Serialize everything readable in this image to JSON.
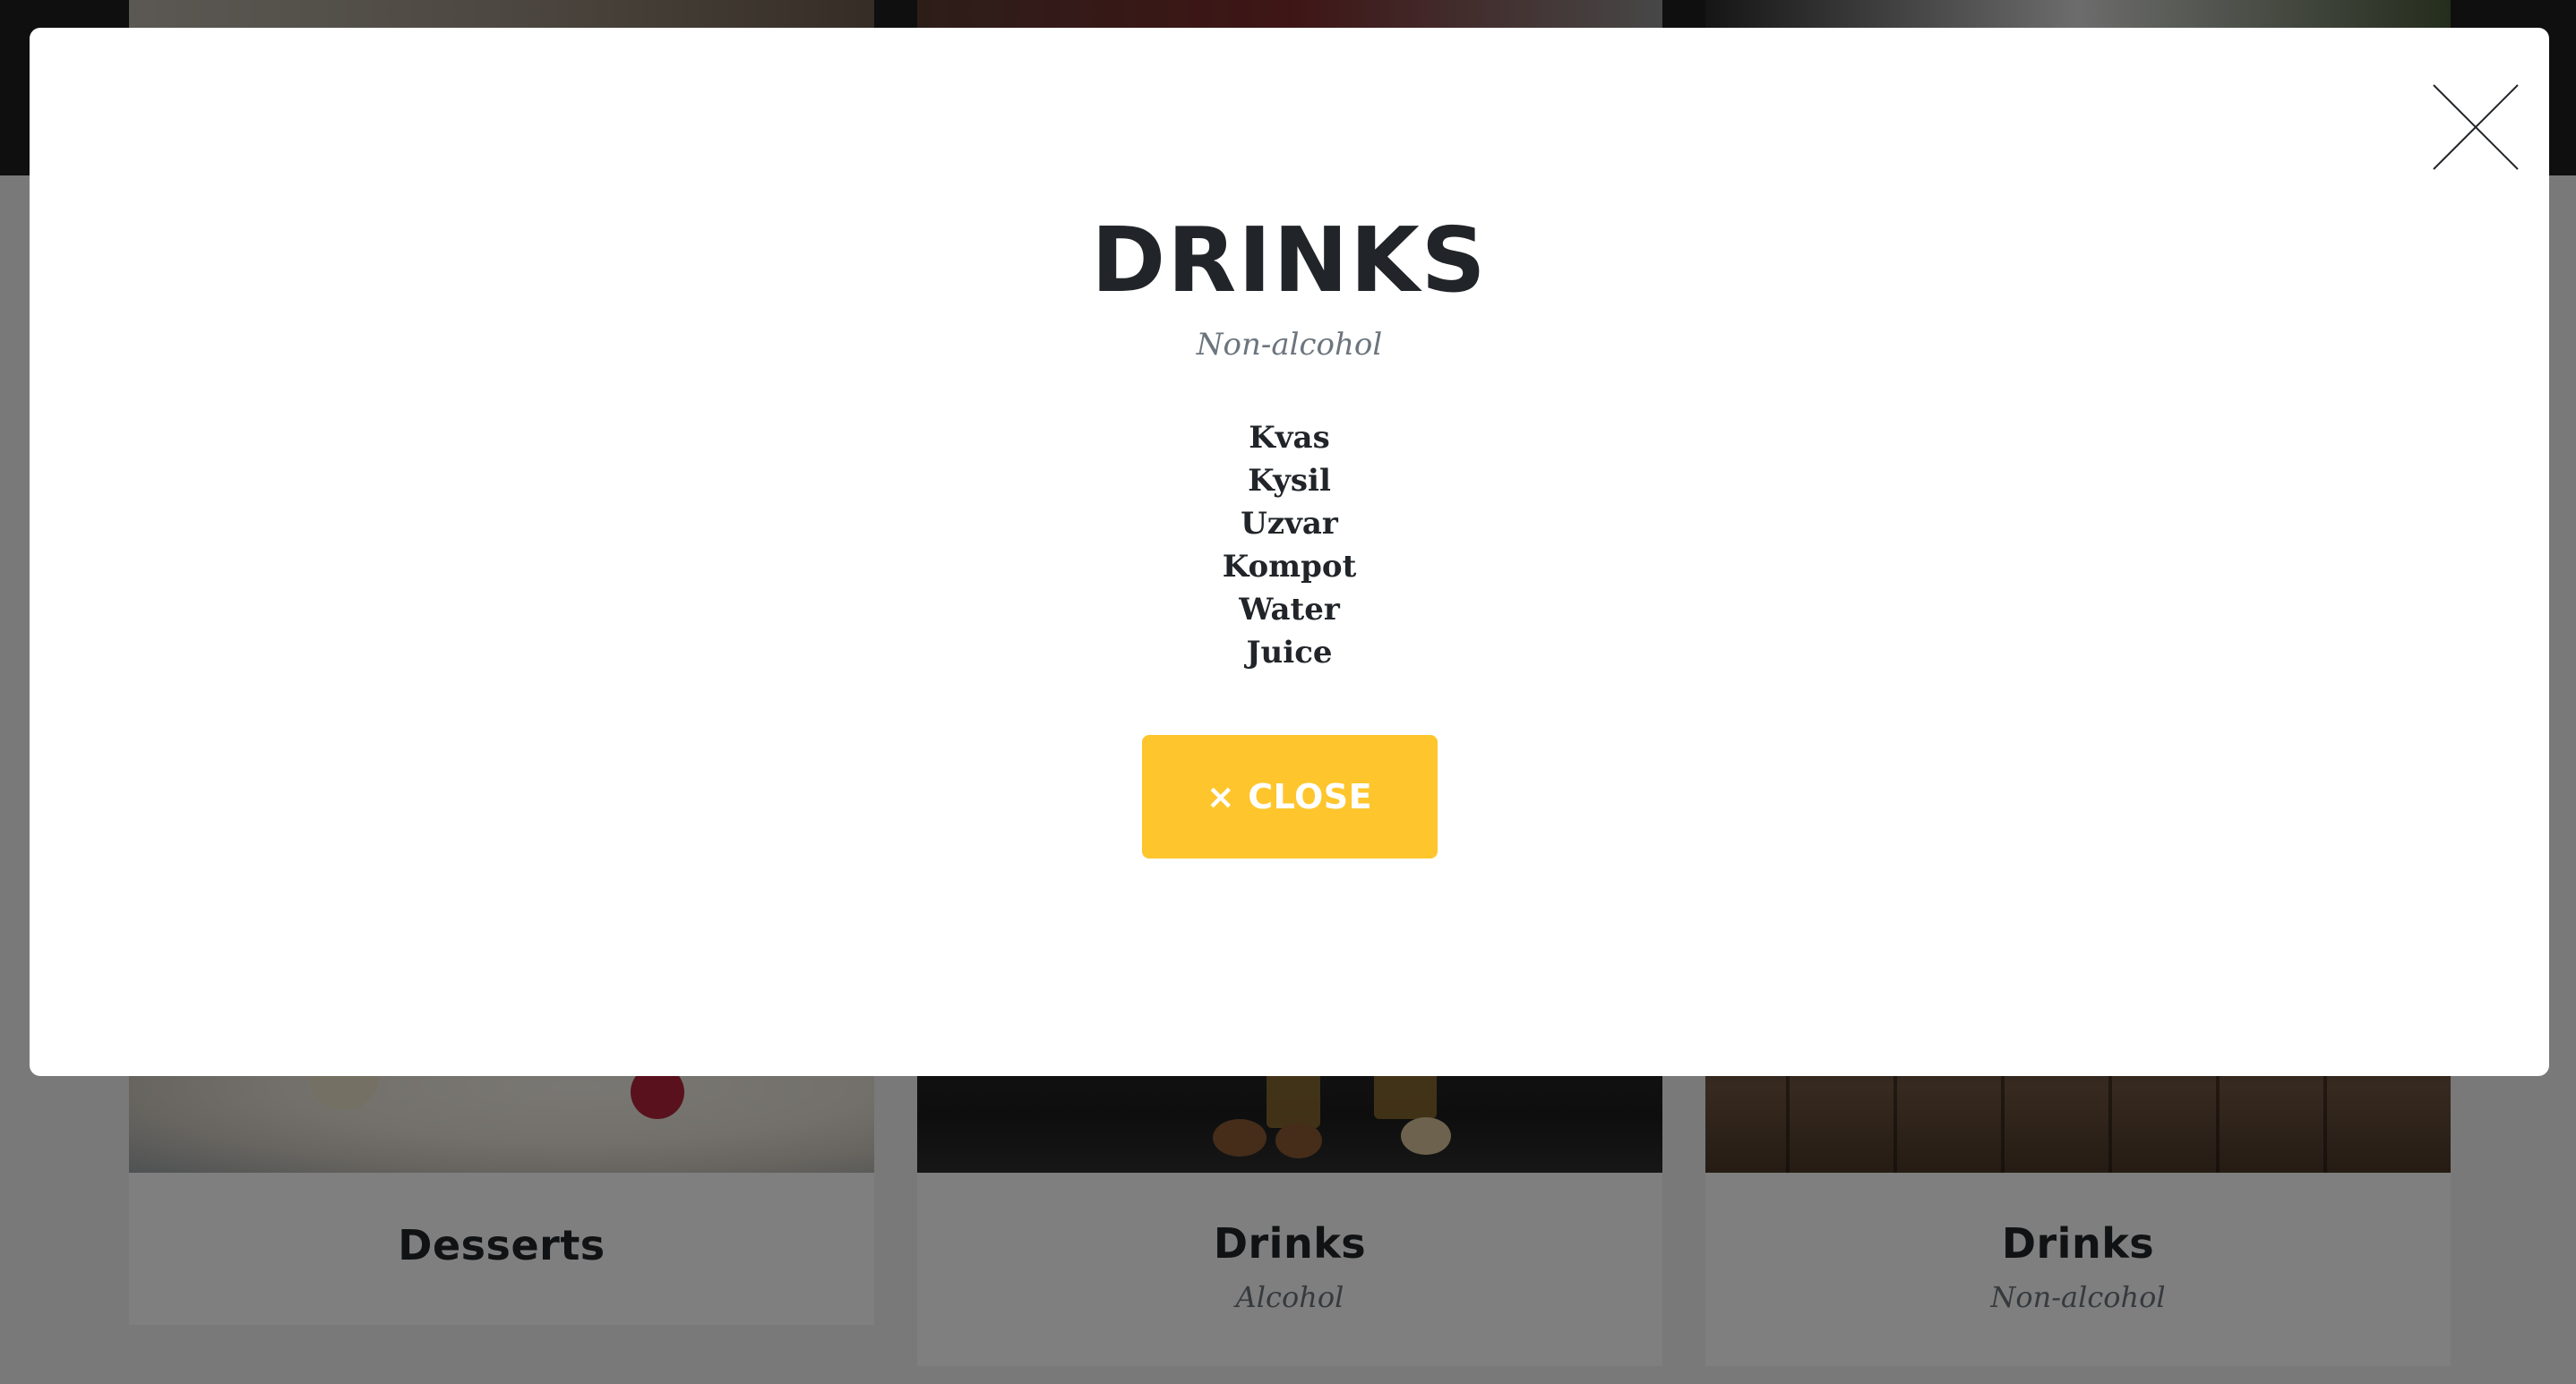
{
  "modal": {
    "title": "DRINKS",
    "subtitle": "Non-alcohol",
    "items": [
      "Kvas",
      "Kysil",
      "Uzvar",
      "Kompot",
      "Water",
      "Juice"
    ],
    "close_button": {
      "icon": "close-icon",
      "glyph": "×",
      "label": "CLOSE"
    },
    "close_icon": "close-x-icon",
    "button_color": "#fec62c"
  },
  "background": {
    "cards": [
      {
        "title": "Desserts",
        "subtitle": ""
      },
      {
        "title": "Drinks",
        "subtitle": "Alcohol"
      },
      {
        "title": "Drinks",
        "subtitle": "Non-alcohol"
      }
    ]
  },
  "colors": {
    "overlay": "rgba(0,0,0,0.5)",
    "heading": "#212529",
    "muted": "#6c757d"
  }
}
